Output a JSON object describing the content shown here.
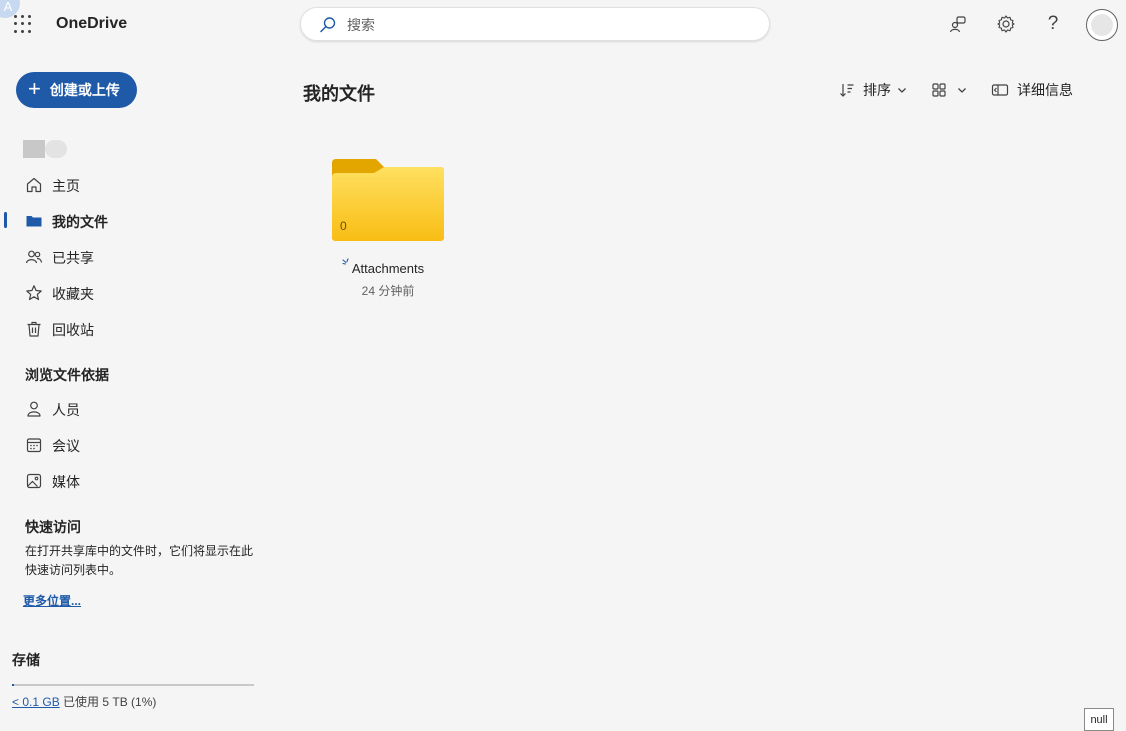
{
  "corner_badge": "A",
  "header": {
    "app_name": "OneDrive",
    "search_placeholder": "搜索",
    "icons": [
      "waffle-icon",
      "feedback-icon",
      "gear-icon",
      "help-icon",
      "avatar"
    ]
  },
  "sidebar": {
    "create_label": "创建或上传",
    "nav": [
      {
        "label": "主页",
        "icon": "home-icon"
      },
      {
        "label": "我的文件",
        "icon": "folder-icon",
        "active": true
      },
      {
        "label": "已共享",
        "icon": "people-icon"
      },
      {
        "label": "收藏夹",
        "icon": "star-icon"
      },
      {
        "label": "回收站",
        "icon": "trash-icon"
      }
    ],
    "browse_title": "浏览文件依据",
    "browse": [
      {
        "label": "人员",
        "icon": "person-icon"
      },
      {
        "label": "会议",
        "icon": "calendar-icon"
      },
      {
        "label": "媒体",
        "icon": "image-icon"
      }
    ],
    "quick_title": "快速访问",
    "quick_desc": "在打开共享库中的文件时，它们将显示在此快速访问列表中。",
    "more_link": "更多位置...",
    "storage_title": "存储",
    "storage_used": "< 0.1 GB",
    "storage_rest": "已使用 5 TB (1%)",
    "storage_percent": 1
  },
  "main": {
    "title": "我的文件",
    "sort_label": "排序",
    "details_label": "详细信息",
    "items": [
      {
        "name": "Attachments",
        "modified": "24 分钟前",
        "count": "0",
        "type": "folder"
      }
    ]
  },
  "footer_badge": "null",
  "colors": {
    "accent": "#1f5aa8",
    "folder": "#f9c51c",
    "background": "#f5f5f5"
  }
}
